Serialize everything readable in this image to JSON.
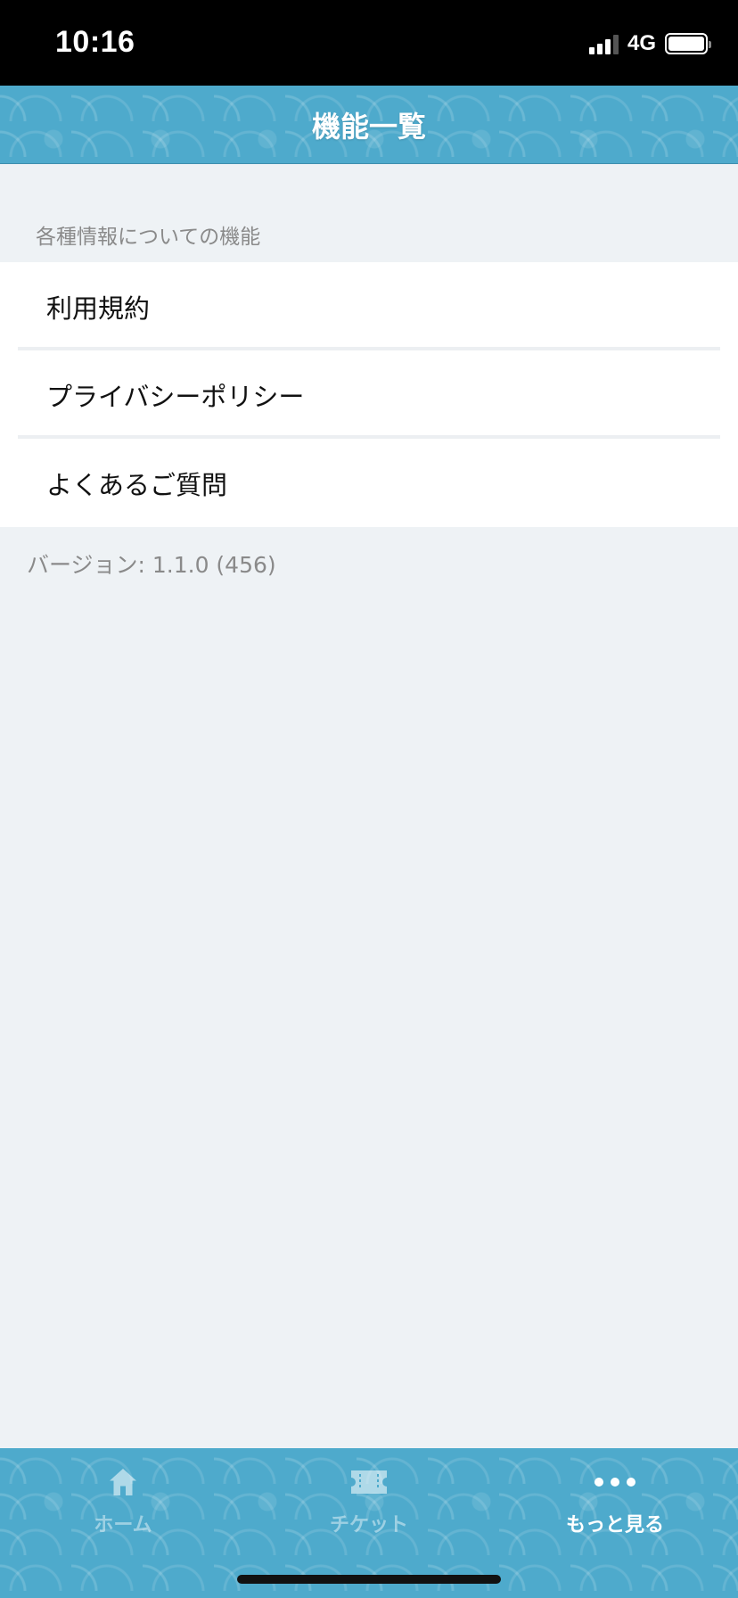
{
  "status_bar": {
    "time": "10:16",
    "network": "4G",
    "signal_bars_active": 3,
    "signal_bars_total": 4,
    "battery_level": 1.0
  },
  "nav": {
    "title": "機能一覧"
  },
  "section": {
    "header": "各種情報についての機能",
    "items": [
      {
        "label": "利用規約"
      },
      {
        "label": "プライバシーポリシー"
      },
      {
        "label": "よくあるご質問"
      }
    ]
  },
  "version_text": "バージョン: 1.1.0 (456)",
  "tab_bar": {
    "tabs": [
      {
        "label": "ホーム",
        "icon": "home-icon",
        "active": false
      },
      {
        "label": "チケット",
        "icon": "ticket-icon",
        "active": false
      },
      {
        "label": "もっと見る",
        "icon": "more-icon",
        "active": true
      }
    ]
  },
  "colors": {
    "header_blue": "#4eaacc",
    "background": "#eef2f5",
    "secondary_text": "#8a8a8a"
  }
}
